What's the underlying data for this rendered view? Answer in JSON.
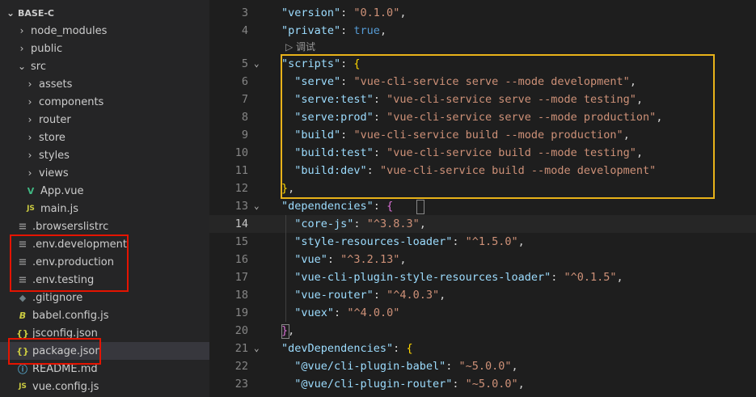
{
  "explorer": {
    "root": "BASE-C",
    "items": [
      {
        "label": "node_modules",
        "chev": "›",
        "kind": "folder",
        "indent": 1
      },
      {
        "label": "public",
        "chev": "›",
        "kind": "folder",
        "indent": 1
      },
      {
        "label": "src",
        "chev": "⌄",
        "kind": "folder",
        "indent": 1
      },
      {
        "label": "assets",
        "chev": "›",
        "kind": "folder",
        "indent": 2
      },
      {
        "label": "components",
        "chev": "›",
        "kind": "folder",
        "indent": 2
      },
      {
        "label": "router",
        "chev": "›",
        "kind": "folder",
        "indent": 2
      },
      {
        "label": "store",
        "chev": "›",
        "kind": "folder",
        "indent": 2
      },
      {
        "label": "styles",
        "chev": "›",
        "kind": "folder",
        "indent": 2
      },
      {
        "label": "views",
        "chev": "›",
        "kind": "folder",
        "indent": 2
      },
      {
        "label": "App.vue",
        "icon": "V",
        "icon_name": "vue-file-icon",
        "kind": "vue",
        "indent": 2
      },
      {
        "label": "main.js",
        "icon": "JS",
        "icon_name": "js-file-icon",
        "kind": "js",
        "indent": 2
      },
      {
        "label": ".browserslistrc",
        "icon": "≡",
        "icon_name": "config-file-icon",
        "kind": "lines",
        "indent": 1
      },
      {
        "label": ".env.development",
        "icon": "≡",
        "icon_name": "env-file-icon",
        "kind": "lines",
        "indent": 1
      },
      {
        "label": ".env.production",
        "icon": "≡",
        "icon_name": "env-file-icon",
        "kind": "lines",
        "indent": 1
      },
      {
        "label": ".env.testing",
        "icon": "≡",
        "icon_name": "env-file-icon",
        "kind": "lines",
        "indent": 1
      },
      {
        "label": ".gitignore",
        "icon": "◆",
        "icon_name": "git-file-icon",
        "kind": "git",
        "indent": 1
      },
      {
        "label": "babel.config.js",
        "icon": "B",
        "icon_name": "babel-file-icon",
        "kind": "babel",
        "indent": 1
      },
      {
        "label": "jsconfig.json",
        "icon": "{}",
        "icon_name": "json-file-icon",
        "kind": "json",
        "indent": 1
      },
      {
        "label": "package.json",
        "icon": "{}",
        "icon_name": "json-file-icon",
        "kind": "json",
        "indent": 1,
        "selected": true
      },
      {
        "label": "README.md",
        "icon": "ⓘ",
        "icon_name": "info-file-icon",
        "kind": "info",
        "indent": 1
      },
      {
        "label": "vue.config.js",
        "icon": "JS",
        "icon_name": "js-file-icon",
        "kind": "js",
        "indent": 1
      }
    ]
  },
  "editor": {
    "codelens": "▷ 调试",
    "lines": [
      {
        "n": "3",
        "tokens": [
          [
            "k",
            "\"version\""
          ],
          [
            "p",
            ": "
          ],
          [
            "s",
            "\"0.1.0\""
          ],
          [
            "p",
            ","
          ]
        ]
      },
      {
        "n": "4",
        "tokens": [
          [
            "k",
            "\"private\""
          ],
          [
            "p",
            ": "
          ],
          [
            "b",
            "true"
          ],
          [
            "p",
            ","
          ]
        ]
      },
      {
        "n": "5",
        "fold": true,
        "tokens": [
          [
            "k",
            "\"scripts\""
          ],
          [
            "p",
            ": "
          ],
          [
            "br1",
            "{"
          ]
        ]
      },
      {
        "n": "6",
        "tokens": [
          [
            "p",
            "  "
          ],
          [
            "k",
            "\"serve\""
          ],
          [
            "p",
            ": "
          ],
          [
            "s",
            "\"vue-cli-service serve --mode development\""
          ],
          [
            "p",
            ","
          ]
        ]
      },
      {
        "n": "7",
        "tokens": [
          [
            "p",
            "  "
          ],
          [
            "k",
            "\"serve:test\""
          ],
          [
            "p",
            ": "
          ],
          [
            "s",
            "\"vue-cli-service serve --mode testing\""
          ],
          [
            "p",
            ","
          ]
        ]
      },
      {
        "n": "8",
        "tokens": [
          [
            "p",
            "  "
          ],
          [
            "k",
            "\"serve:prod\""
          ],
          [
            "p",
            ": "
          ],
          [
            "s",
            "\"vue-cli-service serve --mode production\""
          ],
          [
            "p",
            ","
          ]
        ]
      },
      {
        "n": "9",
        "tokens": [
          [
            "p",
            "  "
          ],
          [
            "k",
            "\"build\""
          ],
          [
            "p",
            ": "
          ],
          [
            "s",
            "\"vue-cli-service build --mode production\""
          ],
          [
            "p",
            ","
          ]
        ]
      },
      {
        "n": "10",
        "tokens": [
          [
            "p",
            "  "
          ],
          [
            "k",
            "\"build:test\""
          ],
          [
            "p",
            ": "
          ],
          [
            "s",
            "\"vue-cli-service build --mode testing\""
          ],
          [
            "p",
            ","
          ]
        ]
      },
      {
        "n": "11",
        "tokens": [
          [
            "p",
            "  "
          ],
          [
            "k",
            "\"build:dev\""
          ],
          [
            "p",
            ": "
          ],
          [
            "s",
            "\"vue-cli-service build --mode development\""
          ]
        ]
      },
      {
        "n": "12",
        "tokens": [
          [
            "br1",
            "}"
          ],
          [
            "p",
            ","
          ]
        ]
      },
      {
        "n": "13",
        "fold": true,
        "tokens": [
          [
            "k",
            "\"dependencies\""
          ],
          [
            "p",
            ": "
          ],
          [
            "br2",
            "{"
          ]
        ]
      },
      {
        "n": "14",
        "current": true,
        "tokens": [
          [
            "p",
            "  "
          ],
          [
            "k",
            "\"core-js\""
          ],
          [
            "p",
            ": "
          ],
          [
            "s",
            "\"^3.8.3\""
          ],
          [
            "p",
            ","
          ]
        ]
      },
      {
        "n": "15",
        "tokens": [
          [
            "p",
            "  "
          ],
          [
            "k",
            "\"style-resources-loader\""
          ],
          [
            "p",
            ": "
          ],
          [
            "s",
            "\"^1.5.0\""
          ],
          [
            "p",
            ","
          ]
        ]
      },
      {
        "n": "16",
        "tokens": [
          [
            "p",
            "  "
          ],
          [
            "k",
            "\"vue\""
          ],
          [
            "p",
            ": "
          ],
          [
            "s",
            "\"^3.2.13\""
          ],
          [
            "p",
            ","
          ]
        ]
      },
      {
        "n": "17",
        "tokens": [
          [
            "p",
            "  "
          ],
          [
            "k",
            "\"vue-cli-plugin-style-resources-loader\""
          ],
          [
            "p",
            ": "
          ],
          [
            "s",
            "\"^0.1.5\""
          ],
          [
            "p",
            ","
          ]
        ]
      },
      {
        "n": "18",
        "tokens": [
          [
            "p",
            "  "
          ],
          [
            "k",
            "\"vue-router\""
          ],
          [
            "p",
            ": "
          ],
          [
            "s",
            "\"^4.0.3\""
          ],
          [
            "p",
            ","
          ]
        ]
      },
      {
        "n": "19",
        "tokens": [
          [
            "p",
            "  "
          ],
          [
            "k",
            "\"vuex\""
          ],
          [
            "p",
            ": "
          ],
          [
            "s",
            "\"^4.0.0\""
          ]
        ]
      },
      {
        "n": "20",
        "tokens": [
          [
            "br2",
            "}"
          ],
          [
            "p",
            ","
          ]
        ]
      },
      {
        "n": "21",
        "fold": true,
        "tokens": [
          [
            "k",
            "\"devDependencies\""
          ],
          [
            "p",
            ": "
          ],
          [
            "br1",
            "{"
          ]
        ]
      },
      {
        "n": "22",
        "tokens": [
          [
            "p",
            "  "
          ],
          [
            "k",
            "\"@vue/cli-plugin-babel\""
          ],
          [
            "p",
            ": "
          ],
          [
            "s",
            "\"~5.0.0\""
          ],
          [
            "p",
            ","
          ]
        ]
      },
      {
        "n": "23",
        "tokens": [
          [
            "p",
            "  "
          ],
          [
            "k",
            "\"@vue/cli-plugin-router\""
          ],
          [
            "p",
            ": "
          ],
          [
            "s",
            "\"~5.0.0\""
          ],
          [
            "p",
            ","
          ]
        ]
      }
    ]
  },
  "colors": {
    "highlight_red": "#e51400",
    "highlight_yellow": "#e8b219"
  }
}
